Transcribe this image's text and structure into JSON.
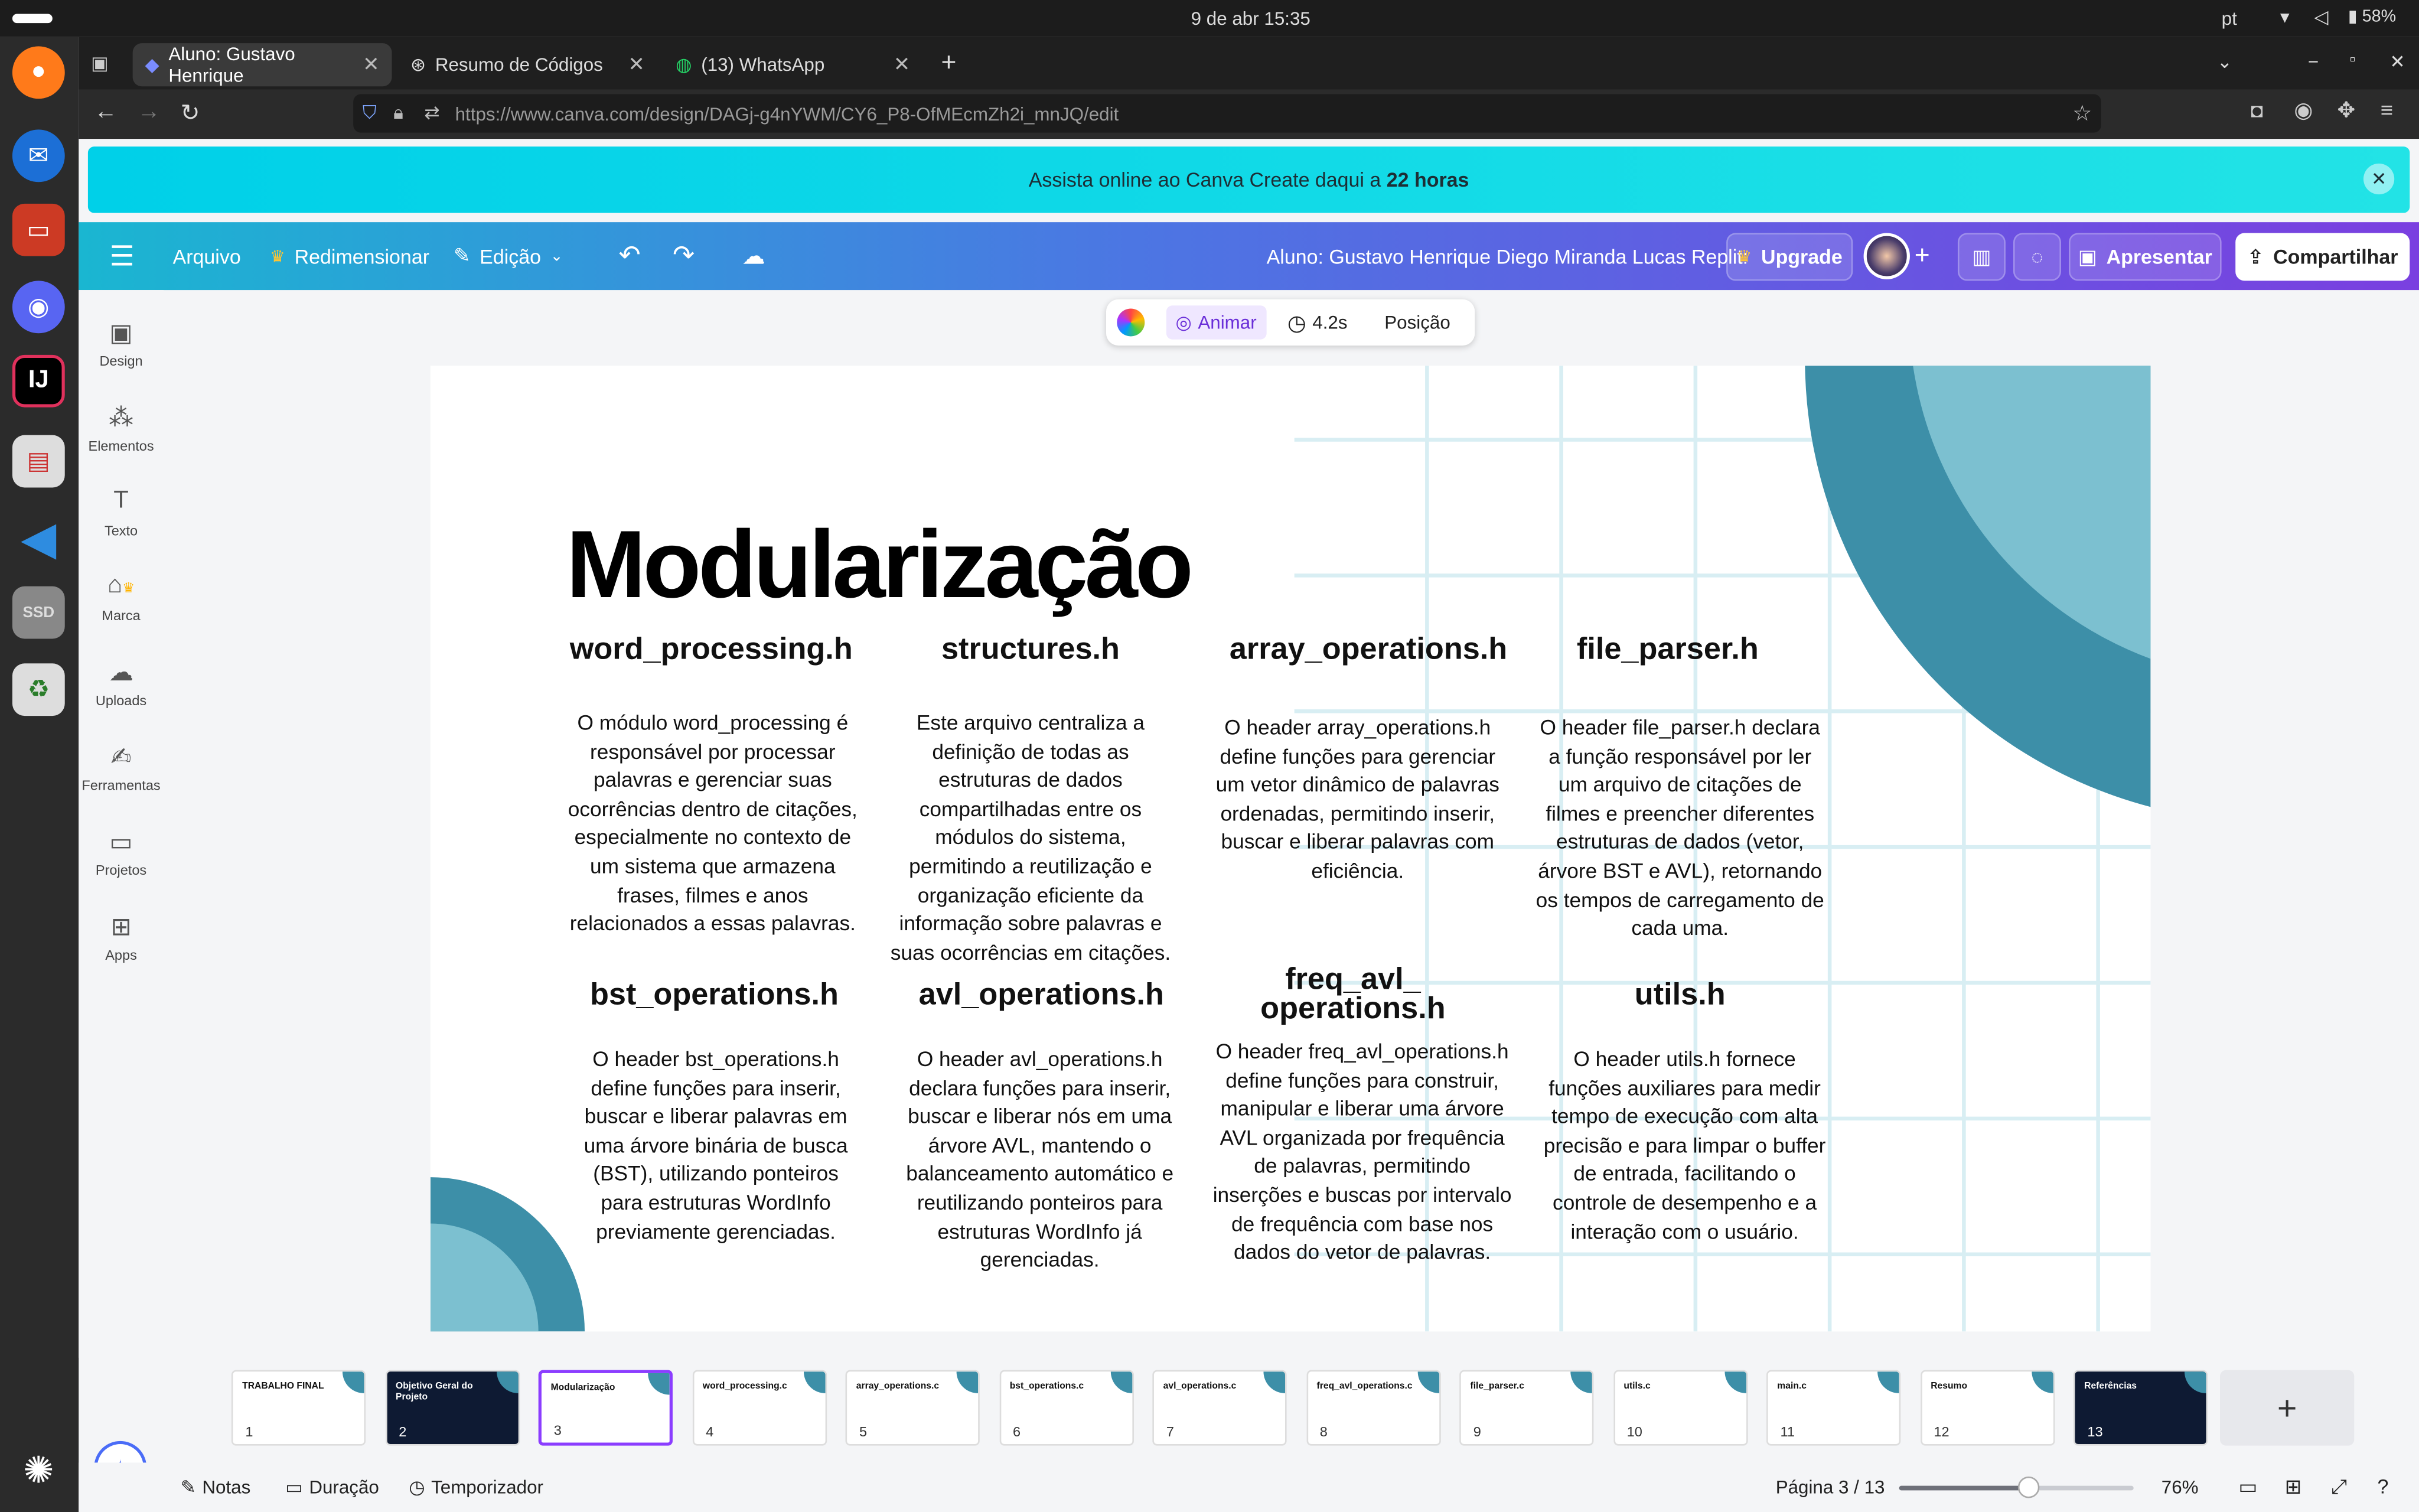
{
  "system": {
    "date_time": "9 de abr  15:35",
    "language": "pt",
    "battery": "58%"
  },
  "browser": {
    "tabs": [
      {
        "label": "Aluno: Gustavo Henrique"
      },
      {
        "label": "Resumo de Códigos"
      },
      {
        "label": "(13) WhatsApp"
      }
    ],
    "url": "https://www.canva.com/design/DAGj-g4nYWM/CY6_P8-OfMEcmZh2i_mnJQ/edit"
  },
  "banner": {
    "text": "Assista online ao Canva Create daqui a ",
    "bold": "22 horas"
  },
  "toolbar": {
    "file": "Arquivo",
    "resize": "Redimensionar",
    "edit": "Edição",
    "doc_title": "Aluno: Gustavo Henrique Diego Miranda Lucas Replit:",
    "upgrade": "Upgrade",
    "present": "Apresentar",
    "share": "Compartilhar"
  },
  "sidebar": {
    "items": [
      {
        "label": "Design"
      },
      {
        "label": "Elementos"
      },
      {
        "label": "Texto"
      },
      {
        "label": "Marca"
      },
      {
        "label": "Uploads"
      },
      {
        "label": "Ferramentas"
      },
      {
        "label": "Projetos"
      },
      {
        "label": "Apps"
      }
    ]
  },
  "context_toolbar": {
    "animate": "Animar",
    "duration": "4.2s",
    "position": "Posição"
  },
  "slide": {
    "title": "Modularização",
    "modules": [
      {
        "name": "word_processing.h",
        "desc": "O módulo word_processing é responsável por processar palavras e gerenciar suas ocorrências dentro de citações, especialmente no contexto de um sistema que armazena frases, filmes e anos relacionados a essas palavras."
      },
      {
        "name": "structures.h",
        "desc": "Este arquivo centraliza a definição de todas as estruturas de dados compartilhadas entre os módulos do sistema, permitindo a reutilização e organização eficiente da informação sobre palavras e suas ocorrências em citações."
      },
      {
        "name": "array_operations.h",
        "desc": "O header array_operations.h define funções para gerenciar um vetor dinâmico de palavras ordenadas, permitindo inserir, buscar e liberar palavras com eficiência."
      },
      {
        "name": "file_parser.h",
        "desc": "O header file_parser.h declara a função responsável por ler um arquivo de citações de filmes e preencher diferentes estruturas de dados (vetor, árvore BST e AVL), retornando os tempos de carregamento de cada uma."
      },
      {
        "name": "bst_operations.h",
        "desc": "O header bst_operations.h define funções para inserir, buscar e liberar palavras em uma árvore binária de busca (BST), utilizando ponteiros para estruturas WordInfo previamente gerenciadas."
      },
      {
        "name": "avl_operations.h",
        "desc": "O header avl_operations.h declara funções para inserir, buscar e liberar nós em uma árvore AVL, mantendo o balanceamento automático e reutilizando ponteiros para estruturas WordInfo já gerenciadas."
      },
      {
        "name": "freq_avl_ operations.h",
        "desc": "O header freq_avl_operations.h define funções para construir, manipular e liberar uma árvore AVL organizada por frequência de palavras, permitindo inserções e buscas por intervalo de frequência com base nos dados do vetor de palavras."
      },
      {
        "name": "utils.h",
        "desc": "O header utils.h fornece funções auxiliares para medir tempo de execução com alta precisão e para limpar o buffer de entrada, facilitando o controle de desempenho e a interação com o usuário."
      }
    ]
  },
  "thumbnails": [
    {
      "num": "1",
      "title": "TRABALHO FINAL",
      "dark": false
    },
    {
      "num": "2",
      "title": "Objetivo Geral do Projeto",
      "dark": true
    },
    {
      "num": "3",
      "title": "Modularização",
      "dark": false
    },
    {
      "num": "4",
      "title": "word_processing.c",
      "dark": false
    },
    {
      "num": "5",
      "title": "array_operations.c",
      "dark": false
    },
    {
      "num": "6",
      "title": "bst_operations.c",
      "dark": false
    },
    {
      "num": "7",
      "title": "avl_operations.c",
      "dark": false
    },
    {
      "num": "8",
      "title": "freq_avl_operations.c",
      "dark": false
    },
    {
      "num": "9",
      "title": "file_parser.c",
      "dark": false
    },
    {
      "num": "10",
      "title": "utils.c",
      "dark": false
    },
    {
      "num": "11",
      "title": "main.c",
      "dark": false
    },
    {
      "num": "12",
      "title": "Resumo",
      "dark": false
    },
    {
      "num": "13",
      "title": "Referências",
      "dark": true
    }
  ],
  "status": {
    "notes": "Notas",
    "duration": "Duração",
    "timer": "Temporizador",
    "page": "Página 3 / 13",
    "zoom": "76%",
    "zoom_level": 0.55
  },
  "colors": {
    "teal_dark": "#3d8fa8",
    "teal_light": "#7cc0d0",
    "selected": "#8b3dff"
  }
}
